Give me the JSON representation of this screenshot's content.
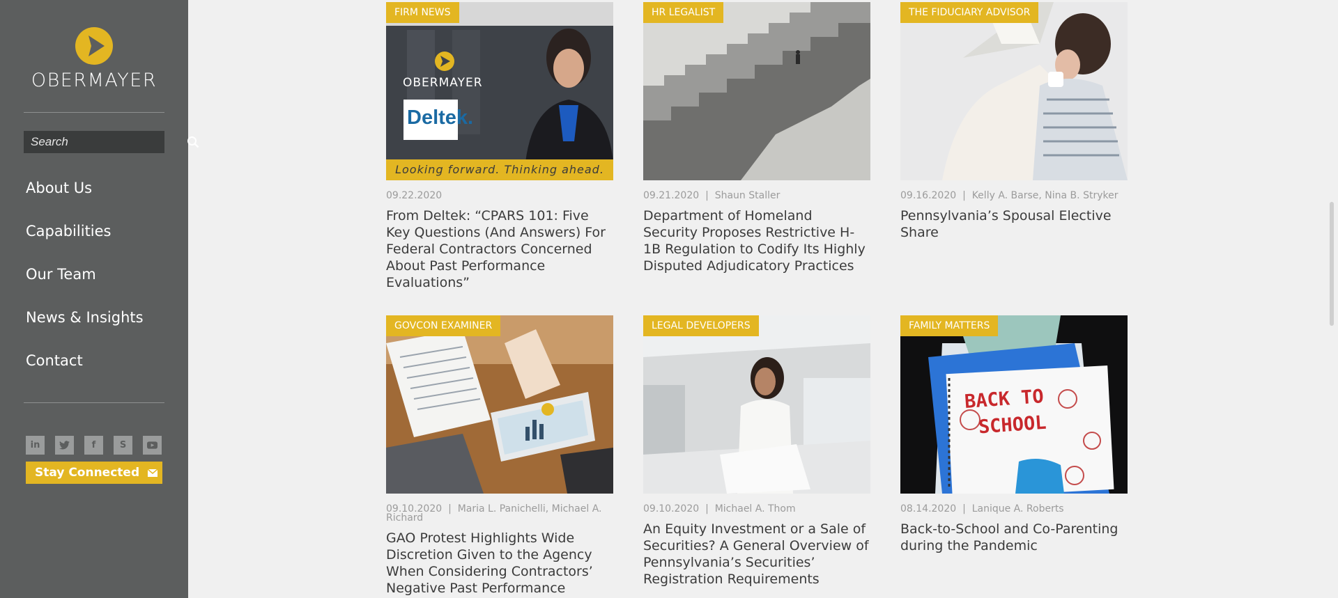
{
  "sidebar": {
    "logo_text": "OBERMAYER",
    "search_placeholder": "Search",
    "nav": [
      "About Us",
      "Capabilities",
      "Our Team",
      "News & Insights",
      "Contact"
    ],
    "social_icons": [
      "linkedin-icon",
      "twitter-icon",
      "facebook-icon",
      "s-icon",
      "youtube-icon"
    ],
    "stay_connected": "Stay Connected",
    "colors": {
      "sidebar_bg": "#5c5e5e",
      "accent": "#e3b622"
    }
  },
  "cards": [
    {
      "tag": "FIRM NEWS",
      "date": "09.22.2020",
      "authors": "",
      "title": "From Deltek: “CPARS 101: Five Key Questions (And Answers) For Federal Contractors Concerned About Past Performance Evaluations”",
      "img_logo": "OBERMAYER",
      "img_brand": "Deltek.",
      "img_caption": "Looking forward. Thinking ahead."
    },
    {
      "tag": "HR LEGALIST",
      "date": "09.21.2020",
      "authors": "Shaun Staller",
      "title": "Department of Homeland Security Proposes Restrictive H-1B Regulation to Codify Its Highly Disputed Adjudicatory Practices"
    },
    {
      "tag": "THE FIDUCIARY ADVISOR",
      "date": "09.16.2020",
      "authors": "Kelly A. Barse, Nina B. Stryker",
      "title": "Pennsylvania’s Spousal Elective Share"
    },
    {
      "tag": "GOVCON EXAMINER",
      "date": "09.10.2020",
      "authors": "Maria L. Panichelli, Michael A. Richard",
      "title": "GAO Protest Highlights Wide Discretion Given to the Agency When Considering Contractors’ Negative Past Performance"
    },
    {
      "tag": "LEGAL DEVELOPERS",
      "date": "09.10.2020",
      "authors": "Michael A. Thom",
      "title": "An Equity Investment or a Sale of Securities? A General Overview of Pennsylvania’s Securities’ Registration Requirements"
    },
    {
      "tag": "FAMILY MATTERS",
      "date": "08.14.2020",
      "authors": "Lanique A. Roberts",
      "title": "Back-to-School and Co-Parenting during the Pandemic",
      "img_text_1": "BACK TO",
      "img_text_2": "SCHOOL"
    }
  ]
}
